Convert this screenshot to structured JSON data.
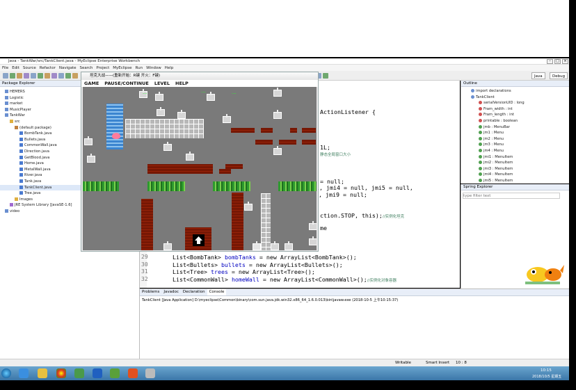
{
  "window": {
    "title": "Java - TankWar/src/TankClient.java - MyEclipse Enterprise Workbench"
  },
  "menubar": [
    "File",
    "Edit",
    "Source",
    "Refactor",
    "Navigate",
    "Search",
    "Project",
    "MyEclipse",
    "Run",
    "Window",
    "Help"
  ],
  "perspectives": [
    "Java",
    "Debug"
  ],
  "package_explorer": {
    "tab": "Package Explorer",
    "items": [
      {
        "label": "HEMERS",
        "level": 1,
        "icon": "project-icon"
      },
      {
        "label": "Logistic",
        "level": 1,
        "icon": "project-icon"
      },
      {
        "label": "market",
        "level": 1,
        "icon": "project-icon"
      },
      {
        "label": "MusicPlayer",
        "level": 1,
        "icon": "project-icon"
      },
      {
        "label": "TankWar",
        "level": 1,
        "icon": "project-icon"
      },
      {
        "label": "src",
        "level": 2,
        "icon": "folder-icon"
      },
      {
        "label": "(default package)",
        "level": 3,
        "icon": "package-icon"
      },
      {
        "label": "BombTank.java",
        "level": 4,
        "icon": "java-file-icon"
      },
      {
        "label": "Bullets.java",
        "level": 4,
        "icon": "java-file-icon"
      },
      {
        "label": "CommonWall.java",
        "level": 4,
        "icon": "java-file-icon"
      },
      {
        "label": "Direction.java",
        "level": 4,
        "icon": "java-file-icon"
      },
      {
        "label": "GetBlood.java",
        "level": 4,
        "icon": "java-file-icon"
      },
      {
        "label": "Home.java",
        "level": 4,
        "icon": "java-file-icon"
      },
      {
        "label": "MetalWall.java",
        "level": 4,
        "icon": "java-file-icon"
      },
      {
        "label": "River.java",
        "level": 4,
        "icon": "java-file-icon"
      },
      {
        "label": "Tank.java",
        "level": 4,
        "icon": "java-file-icon"
      },
      {
        "label": "TankClient.java",
        "level": 4,
        "icon": "java-file-icon",
        "selected": true
      },
      {
        "label": "Tree.java",
        "level": 4,
        "icon": "java-file-icon"
      },
      {
        "label": "Images",
        "level": 3,
        "icon": "folder-icon"
      },
      {
        "label": "JRE System Library [JavaSE-1.6]",
        "level": 2,
        "icon": "library-icon"
      },
      {
        "label": "video",
        "level": 1,
        "icon": "project-icon"
      }
    ]
  },
  "outline": {
    "tab": "Outline",
    "items": [
      "import declarations",
      "TankClient",
      "serialVersionUID : long",
      "Fram_width : int",
      "Fram_length : int",
      "printable : boolean",
      "jmb : MenuBar",
      "jm1 : Menu",
      "jm2 : Menu",
      "jm3 : Menu",
      "jm4 : Menu",
      "jmi1 : MenuItem",
      "jmi2 : MenuItem",
      "jmi3 : MenuItem",
      "jmi4 : MenuItem",
      "jmi5 : MenuItem"
    ]
  },
  "spring_explorer": {
    "tab": "Spring Explorer",
    "filter_placeholder": "type filter text"
  },
  "editor": {
    "partial": [
      "ActionListener {",
      "1L;",
      "静态全局窗口大小",
      "= null;",
      "l, jmi4 = null, jmi5 = null,",
      ", jmi9 = null;",
      "ction.STOP, this);",
      "//实例化坦克",
      "me"
    ],
    "lines": [
      {
        "num": "29",
        "type": "List<BombTank>",
        "name": "bombTanks",
        "init": " = new ArrayList<BombTank>();",
        "comment": ""
      },
      {
        "num": "30",
        "type": "List<Bullets>",
        "name": "bullets",
        "init": " = new ArrayList<Bullets>();",
        "comment": ""
      },
      {
        "num": "31",
        "type": "List<Tree>",
        "name": "trees",
        "init": " = new ArrayList<Tree>();",
        "comment": ""
      },
      {
        "num": "32",
        "type": "List<CommonWall>",
        "name": "homeWall",
        "init": " = new ArrayList<CommonWall>();",
        "comment": "//实例化对象容器"
      }
    ]
  },
  "console": {
    "tabs": [
      "Problems",
      "Javadoc",
      "Declaration",
      "Console"
    ],
    "header": "TankClient [Java Application] D:\\myeclipse\\Common\\binary\\com.sun.java.jdk.win32.x86_64_1.6.0.013\\bin\\javaw.exe (2018-10-5 上午10:15:37)"
  },
  "statusbar": {
    "mode": "Writable",
    "insert": "Smart Insert",
    "position": "10 : 8"
  },
  "taskbar": {
    "time": "10:15",
    "date": "2018/10/5 星期五"
  },
  "game": {
    "title": "坦克大战——(重新开始：R键 开火：F键)",
    "menu": [
      "GAME",
      "PAUSE/CONTINUE",
      "LEVEL",
      "HELP"
    ],
    "hud": [
      "...",
      "...",
      "..."
    ]
  },
  "colors": {
    "hud_green": "#29ff29",
    "keyword": "#7f0055",
    "field_blue": "#0000c0",
    "comment": "#3f7f5f"
  }
}
